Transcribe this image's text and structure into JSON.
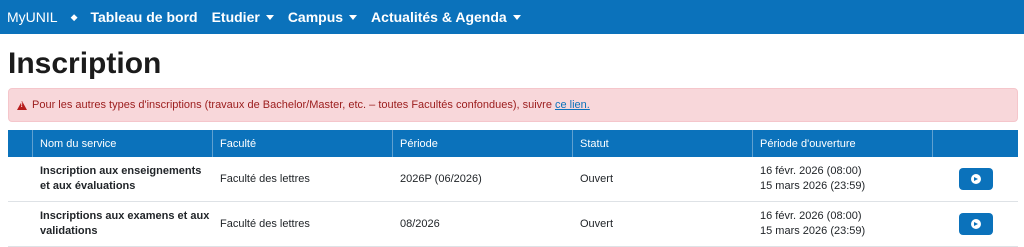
{
  "navbar": {
    "brand": "MyUNIL",
    "separator": "◆",
    "items": [
      {
        "label": "Tableau de bord",
        "dropdown": false
      },
      {
        "label": "Etudier",
        "dropdown": true
      },
      {
        "label": "Campus",
        "dropdown": true
      },
      {
        "label": "Actualités & Agenda",
        "dropdown": true
      }
    ]
  },
  "page": {
    "title": "Inscription"
  },
  "alert": {
    "text": "Pour les autres types d'inscriptions (travaux de Bachelor/Master, etc. – toutes Facultés confondues), suivre",
    "link": "ce lien."
  },
  "table": {
    "headers": [
      "Nom du service",
      "Faculté",
      "Période",
      "Statut",
      "Période d'ouverture"
    ],
    "rows": [
      {
        "service_line1": "Inscription aux enseignements",
        "service_line2": "et aux évaluations",
        "faculty": "Faculté des lettres",
        "period": "2026P (06/2026)",
        "status": "Ouvert",
        "open_from": "16 févr. 2026 (08:00)",
        "open_to": "15 mars 2026 (23:59)"
      },
      {
        "service_line1": "Inscriptions aux examens et aux",
        "service_line2": "validations",
        "faculty": "Faculté des lettres",
        "period": "08/2026",
        "status": "Ouvert",
        "open_from": "16 févr. 2026 (08:00)",
        "open_to": "15 mars 2026 (23:59)"
      }
    ]
  },
  "colors": {
    "primary": "#0b72bb",
    "alert_bg": "#f8d7da",
    "alert_text": "#9b1c1c"
  },
  "icons": {
    "row_action": "arrow-circle-right-icon",
    "alert": "warning-triangle-icon"
  }
}
